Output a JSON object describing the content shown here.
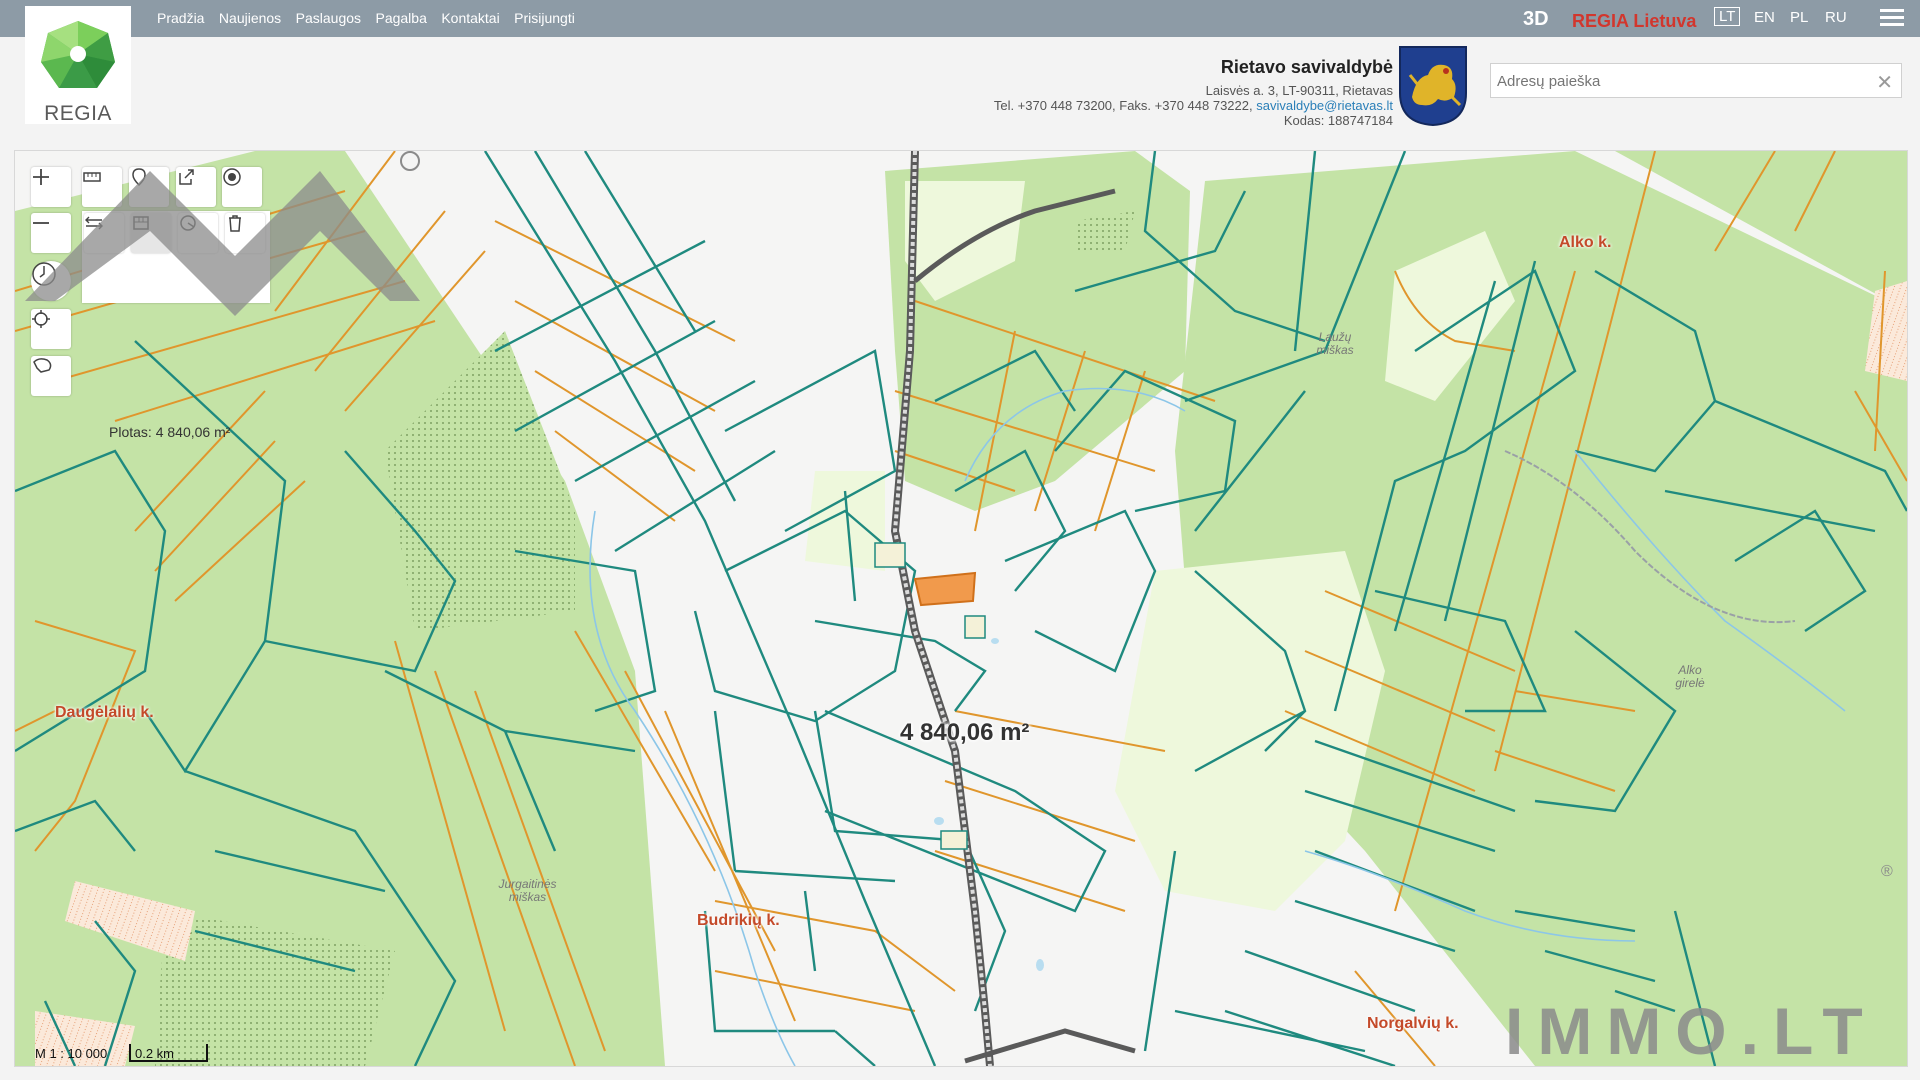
{
  "nav": {
    "items": [
      "Pradžia",
      "Naujienos",
      "Paslaugos",
      "Pagalba",
      "Kontaktai",
      "Prisijungti"
    ]
  },
  "logo": {
    "text": "REGIA"
  },
  "top_right": {
    "mode_3d": "3D",
    "regia_lietuva": "REGIA Lietuva",
    "languages": [
      "LT",
      "EN",
      "PL",
      "RU"
    ],
    "active_language": "LT"
  },
  "municipality": {
    "name": "Rietavo savivaldybė",
    "address": "Laisvės a. 3, LT-90311, Rietavas",
    "contacts": "Tel. +370 448 73200, Faks. +370 448 73222,",
    "email": "savivaldybe@rietavas.lt",
    "code": "Kodas: 188747184"
  },
  "search": {
    "placeholder": "Adresų paieška",
    "value": ""
  },
  "tools": {
    "area_label": "Plotas: 4 840,06 m²",
    "icons": [
      "zoom-in-icon",
      "zoom-out-icon",
      "ruler-icon",
      "pin-icon",
      "share-icon",
      "target-icon",
      "measure-distance-icon",
      "measure-area-icon",
      "measure-radius-icon",
      "trash-icon",
      "history-icon",
      "locate-icon",
      "lasso-icon"
    ]
  },
  "map": {
    "measurement": "4 840,06 m²",
    "places": [
      "Alko k.",
      "Daugėlalių k.",
      "Budrikių k.",
      "Norgalvių k."
    ],
    "forests": [
      "Laužų miškas",
      "Alko girelė",
      "Jurgaitinės miškas"
    ],
    "scale_ratio": "M 1 : 10 000",
    "scale_bar": "0.2 km",
    "colors": {
      "forest": "#c4e3a6",
      "meadow": "#eef8dc",
      "parcel_teal": "#1f8a7f",
      "parcel_orange": "#e0962c",
      "road": "#7a7a7a"
    }
  },
  "watermark": {
    "text": "IMMO.LT",
    "registered": "®"
  }
}
